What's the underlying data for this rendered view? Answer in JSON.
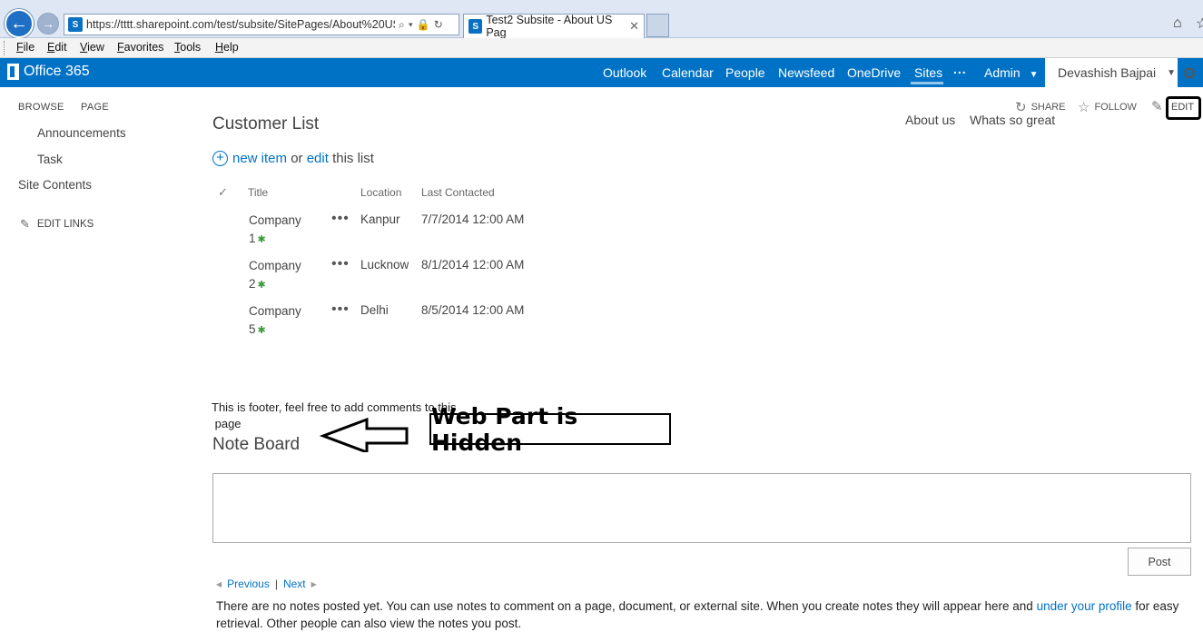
{
  "browser": {
    "url": "https://tttt.sharepoint.com/test/subsite/SitePages/About%20US",
    "tab_title": "Test2 Subsite - About US Pag",
    "back_glyph": "←",
    "forward_glyph": "→"
  },
  "menu": [
    "File",
    "Edit",
    "View",
    "Favorites",
    "Tools",
    "Help"
  ],
  "suite": {
    "brand": "Office 365",
    "links": [
      "Outlook",
      "Calendar",
      "People",
      "Newsfeed",
      "OneDrive",
      "Sites",
      "...",
      "Admin"
    ],
    "user": "Devashish Bajpai"
  },
  "ribbon": {
    "tabs": [
      "BROWSE",
      "PAGE"
    ],
    "share": "SHARE",
    "follow": "FOLLOW",
    "edit": "EDIT"
  },
  "left_nav": {
    "items": [
      "Announcements",
      "Task"
    ],
    "site_contents": "Site Contents",
    "edit_links": "EDIT LINKS"
  },
  "top_nav": [
    "About us",
    "Whats so great"
  ],
  "list": {
    "title": "Customer List",
    "new_item": "new item",
    "or": " or ",
    "edit": "edit",
    "this_list": " this list",
    "columns": [
      "Title",
      "Location",
      "Last Contacted"
    ],
    "rows": [
      {
        "title_line1": "Company",
        "title_line2": "1",
        "location": "Kanpur",
        "last_contacted": "7/7/2014 12:00 AM"
      },
      {
        "title_line1": "Company",
        "title_line2": "2",
        "location": "Lucknow",
        "last_contacted": "8/1/2014 12:00 AM"
      },
      {
        "title_line1": "Company",
        "title_line2": "5",
        "location": "Delhi",
        "last_contacted": "8/5/2014 12:00 AM"
      }
    ]
  },
  "footer": {
    "text_line1": "This is footer, feel free to add comments to this",
    "text_line2": " page"
  },
  "note_board": {
    "title": "Note Board",
    "annotation": "Web Part is Hidden",
    "post": "Post",
    "previous": "Previous",
    "separator": "|",
    "next": "Next",
    "empty_message": "There are no notes posted yet. You can use notes to comment on a page, document, or external site. When you create notes they will appear here and ",
    "profile_link": "under your profile",
    "empty_message_end": " for easy retrieval. Other people can also view the notes you post."
  },
  "colors": {
    "suite_blue": "#0072c6",
    "link_blue": "#0072c6"
  }
}
